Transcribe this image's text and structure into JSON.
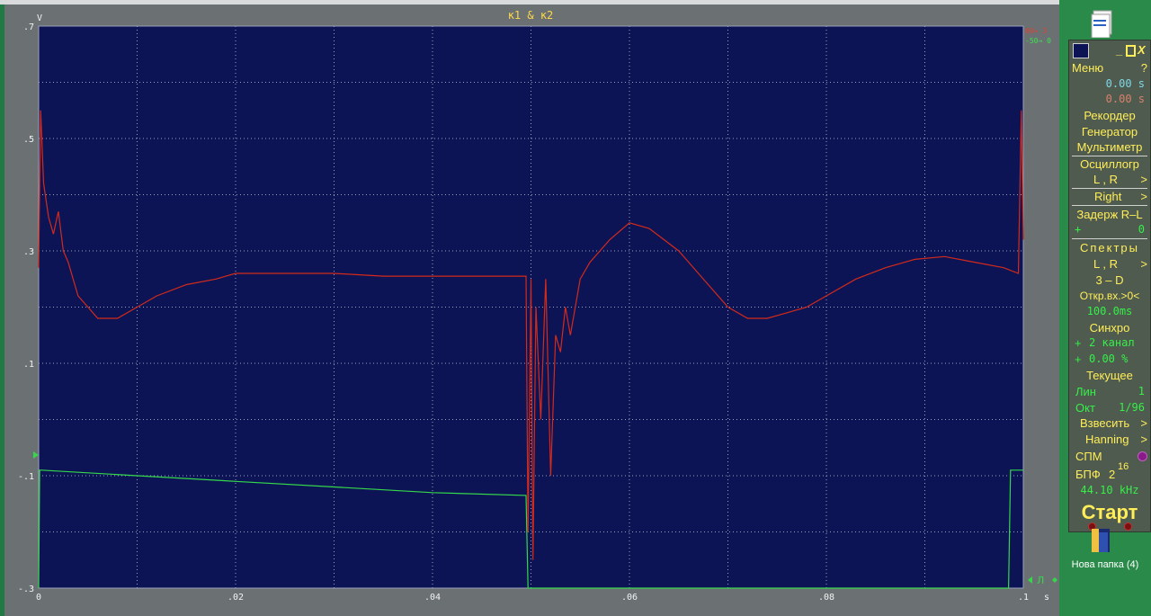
{
  "chart_data": {
    "type": "line",
    "title": "к1 & к2",
    "xlabel": "s",
    "ylabel": "V",
    "xlim": [
      0,
      0.1
    ],
    "ylim": [
      -0.3,
      0.7
    ],
    "x_ticks": [
      "0",
      ".02",
      ".04",
      ".06",
      ".08",
      ".1"
    ],
    "y_ticks": [
      ".7",
      ".5",
      ".3",
      ".1",
      "-.1",
      "-.3"
    ],
    "grid": true,
    "series": [
      {
        "color": "#d42a1a",
        "x": [
          0,
          0.0002,
          0.0005,
          0.001,
          0.0015,
          0.002,
          0.0025,
          0.003,
          0.004,
          0.005,
          0.006,
          0.007,
          0.008,
          0.01,
          0.012,
          0.015,
          0.018,
          0.02,
          0.025,
          0.03,
          0.035,
          0.04,
          0.045,
          0.0495,
          0.0497,
          0.05,
          0.0502,
          0.0505,
          0.051,
          0.0515,
          0.052,
          0.0525,
          0.053,
          0.0535,
          0.054,
          0.055,
          0.056,
          0.058,
          0.06,
          0.062,
          0.065,
          0.068,
          0.07,
          0.072,
          0.074,
          0.076,
          0.078,
          0.08,
          0.083,
          0.086,
          0.089,
          0.092,
          0.095,
          0.098,
          0.0995,
          0.0998,
          0.1
        ],
        "y": [
          0.27,
          0.55,
          0.42,
          0.36,
          0.33,
          0.37,
          0.3,
          0.28,
          0.22,
          0.2,
          0.18,
          0.18,
          0.18,
          0.2,
          0.22,
          0.24,
          0.25,
          0.26,
          0.26,
          0.26,
          0.255,
          0.255,
          0.255,
          0.255,
          -0.2,
          0.25,
          -0.25,
          0.2,
          0.0,
          0.25,
          -0.1,
          0.15,
          0.12,
          0.2,
          0.15,
          0.25,
          0.28,
          0.32,
          0.35,
          0.34,
          0.3,
          0.24,
          0.2,
          0.18,
          0.18,
          0.19,
          0.2,
          0.22,
          0.25,
          0.27,
          0.285,
          0.29,
          0.28,
          0.27,
          0.26,
          0.55,
          0.32
        ]
      },
      {
        "color": "#34d84a",
        "x": [
          0,
          0.0001,
          0.0003,
          0.01,
          0.02,
          0.03,
          0.04,
          0.0495,
          0.0497,
          0.05,
          0.0502,
          0.06,
          0.07,
          0.08,
          0.09,
          0.0985,
          0.0987,
          0.1
        ],
        "y": [
          -0.3,
          -0.09,
          -0.09,
          -0.1,
          -0.11,
          -0.12,
          -0.13,
          -0.135,
          -0.3,
          -0.3,
          -0.3,
          -0.3,
          -0.3,
          -0.3,
          -0.3,
          -0.3,
          -0.09,
          -0.09
        ]
      }
    ]
  },
  "top_right": {
    "line1": "00→ 3",
    "line2": "-50→ 0"
  },
  "bottom_right_marker": "Л",
  "panel": {
    "menu": "Меню",
    "help": "?",
    "time1": "0.00 s",
    "time2": "0.00 s",
    "recorder": "Рекордер",
    "generator": "Генератор",
    "multimeter": "Мультиметр",
    "oscillograph": "Осциллогр",
    "lr1": "L , R",
    "right": "Right",
    "delay": "Задерж R–L",
    "delay_sign": "+",
    "delay_val": "0",
    "spectra": "Спектры",
    "lr2": "L , R",
    "three_d": "3 – D",
    "openin": "Откр.вх.>0<",
    "openin_val": "100.0ms",
    "sync": "Синхро",
    "sync_sign1": "+",
    "sync_channel": "2 канал",
    "sync_sign2": "+",
    "sync_pct": "0.00 %",
    "current": "Текущее",
    "lin": "Лин",
    "lin_val": "1",
    "oct": "Окт",
    "oct_val": "1/96",
    "weigh": "Взвесить",
    "hanning": "Hanning",
    "spm": "СПМ",
    "fft": "БПФ",
    "fft_base": "2",
    "fft_exp": "16",
    "rate": "44.10 kHz",
    "start": "Старт"
  },
  "desktop": {
    "folder_label": "Нова папка (4)"
  },
  "colors": {
    "plot_bg": "#0c1456",
    "grid": "#9aa0b8",
    "frame_bg": "#6b7173",
    "panel_bg": "#4f5b4f",
    "panel_yellow": "#ffee58",
    "panel_green": "#34f048"
  }
}
